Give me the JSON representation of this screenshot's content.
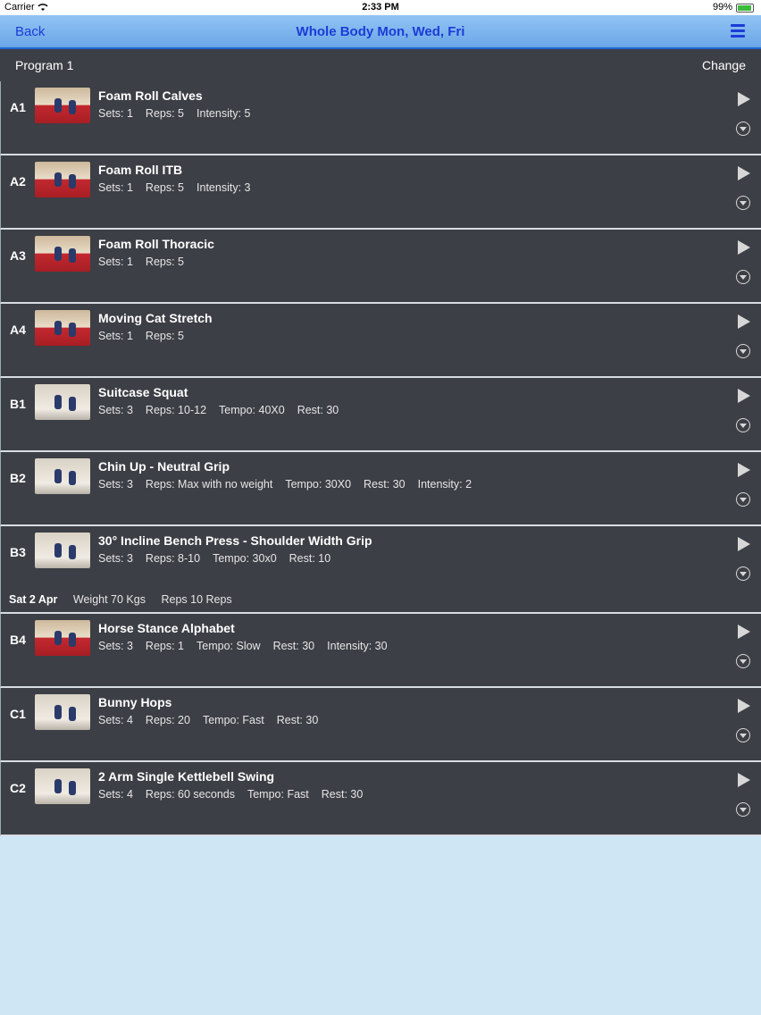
{
  "status_bar": {
    "carrier": "Carrier",
    "time": "2:33 PM",
    "battery": "99%"
  },
  "nav": {
    "back_label": "Back",
    "title": "Whole Body Mon, Wed, Fri",
    "menu_icon": "hamburger-menu-icon"
  },
  "program": {
    "name": "Program 1",
    "change_label": "Change"
  },
  "exercises": [
    {
      "code": "A1",
      "name": "Foam Roll Calves",
      "details": [
        "Sets: 1",
        "Reps: 5",
        "Intensity: 5"
      ]
    },
    {
      "code": "A2",
      "name": "Foam Roll ITB",
      "details": [
        "Sets: 1",
        "Reps: 5",
        "Intensity: 3"
      ]
    },
    {
      "code": "A3",
      "name": "Foam Roll Thoracic",
      "details": [
        "Sets: 1",
        "Reps: 5"
      ]
    },
    {
      "code": "A4",
      "name": "Moving Cat Stretch",
      "details": [
        "Sets: 1",
        "Reps: 5"
      ]
    },
    {
      "code": "B1",
      "name": "Suitcase Squat",
      "details": [
        "Sets: 3",
        "Reps: 10-12",
        "Tempo: 40X0",
        "Rest: 30"
      ]
    },
    {
      "code": "B2",
      "name": "Chin Up - Neutral Grip",
      "details": [
        "Sets: 3",
        "Reps: Max with no weight",
        "Tempo: 30X0",
        "Rest: 30",
        "Intensity: 2"
      ]
    },
    {
      "code": "B3",
      "name": "30° Incline Bench Press - Shoulder Width Grip",
      "details": [
        "Sets: 3",
        "Reps: 8-10",
        "Tempo: 30x0",
        "Rest: 10"
      ],
      "history": {
        "date": "Sat 2 Apr",
        "weight": "Weight 70 Kgs",
        "reps": "Reps 10 Reps"
      }
    },
    {
      "code": "B4",
      "name": "Horse Stance Alphabet",
      "details": [
        "Sets: 3",
        "Reps: 1",
        "Tempo: Slow",
        "Rest: 30",
        "Intensity: 30"
      ]
    },
    {
      "code": "C1",
      "name": "Bunny Hops",
      "details": [
        "Sets: 4",
        "Reps: 20",
        "Tempo: Fast",
        "Rest: 30"
      ]
    },
    {
      "code": "C2",
      "name": "2 Arm Single Kettlebell Swing",
      "details": [
        "Sets: 4",
        "Reps: 60 seconds",
        "Tempo: Fast",
        "Rest: 30"
      ]
    }
  ]
}
